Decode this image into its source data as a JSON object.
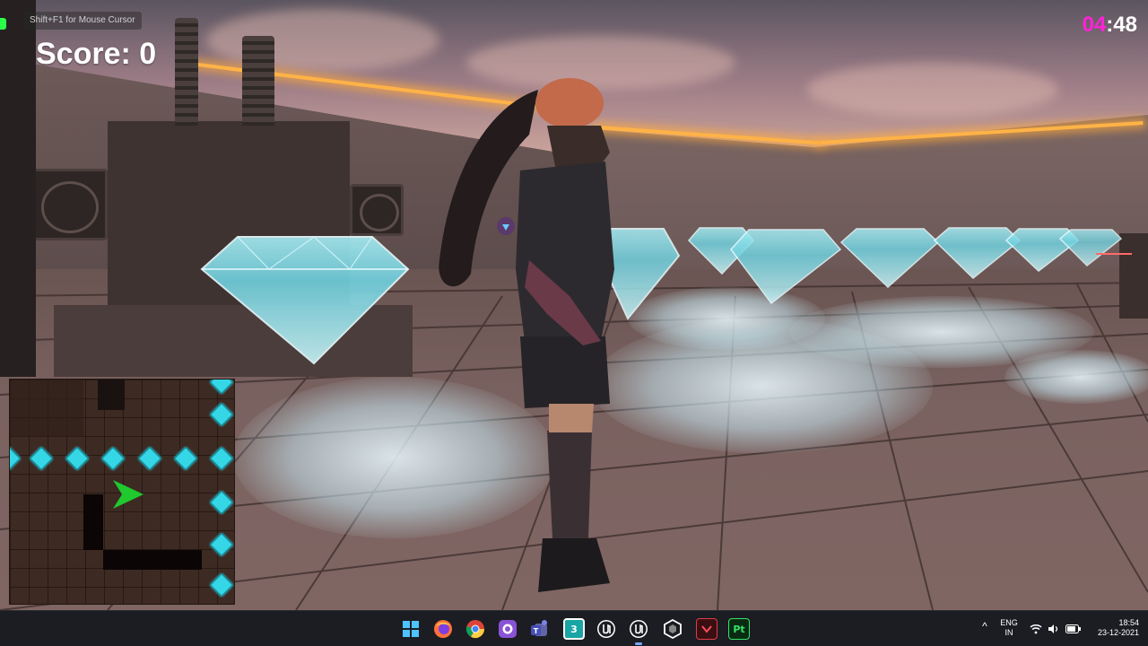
{
  "hud": {
    "hint": "Shift+F1 for Mouse Cursor",
    "score": "Score: 0",
    "timer_minutes": "04",
    "timer_separator": ":",
    "timer_seconds": "48",
    "accent_timer_color": "#ff22d8"
  },
  "minimap": {
    "gem_color": "#35d7e6",
    "player_color": "#1fc92e",
    "gem_icon": "diamond-icon",
    "player_icon": "player-arrow-icon"
  },
  "taskbar": {
    "apps": [
      {
        "name": "windows-start",
        "icon": "windows-logo-icon"
      },
      {
        "name": "firefox",
        "icon": "firefox-icon"
      },
      {
        "name": "chrome",
        "icon": "chrome-icon"
      },
      {
        "name": "github-desktop",
        "icon": "github-icon"
      },
      {
        "name": "teams",
        "icon": "teams-icon"
      },
      {
        "name": "3ds-max",
        "icon": "3ds-max-icon",
        "label": "3"
      },
      {
        "name": "unreal-engine-1",
        "icon": "unreal-icon"
      },
      {
        "name": "unreal-engine-2",
        "icon": "unreal-icon"
      },
      {
        "name": "unity-hub",
        "icon": "unity-icon"
      },
      {
        "name": "app-red",
        "icon": "chevron-down-icon"
      },
      {
        "name": "substance-painter",
        "icon": "painter-icon",
        "label": "Pt"
      }
    ],
    "tray": {
      "chevron": "^",
      "lang_line1": "ENG",
      "lang_line2": "IN",
      "time": "18:54",
      "date": "23-12-2021"
    }
  }
}
